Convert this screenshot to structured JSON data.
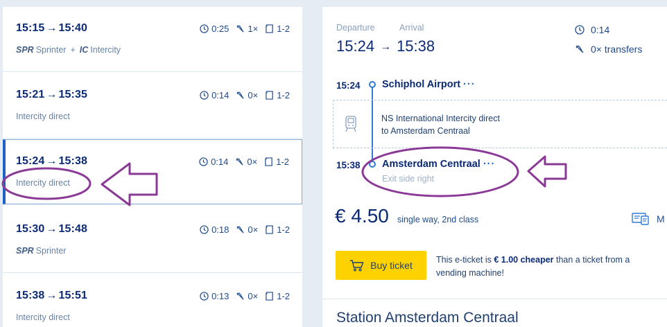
{
  "trips": [
    {
      "dep": "15:15",
      "arr": "15:40",
      "duration": "0:25",
      "transfers": "1×",
      "classes": "1-2",
      "type_text": "",
      "segments": [
        {
          "code": "SPR",
          "name": "Sprinter"
        },
        {
          "code": "IC",
          "name": "Intercity"
        }
      ],
      "plus": "+"
    },
    {
      "dep": "15:21",
      "arr": "15:35",
      "duration": "0:14",
      "transfers": "0×",
      "classes": "1-2",
      "type_text": "Intercity direct",
      "segments": []
    },
    {
      "dep": "15:24",
      "arr": "15:38",
      "duration": "0:14",
      "transfers": "0×",
      "classes": "1-2",
      "type_text": "Intercity direct",
      "segments": []
    },
    {
      "dep": "15:30",
      "arr": "15:48",
      "duration": "0:18",
      "transfers": "0×",
      "classes": "1-2",
      "type_text": "",
      "segments": [
        {
          "code": "SPR",
          "name": "Sprinter"
        }
      ]
    },
    {
      "dep": "15:38",
      "arr": "15:51",
      "duration": "0:13",
      "transfers": "0×",
      "classes": "1-2",
      "type_text": "Intercity direct",
      "segments": []
    }
  ],
  "arrow_glyph": "→",
  "detail": {
    "departure_label": "Departure",
    "arrival_label": "Arrival",
    "dep_time": "15:24",
    "arr_time": "15:38",
    "duration": "0:14",
    "transfers": "0× transfers",
    "origin_time": "15:24",
    "origin_name": "Schiphol Airport",
    "dest_time": "15:38",
    "dest_name": "Amsterdam Centraal",
    "more_dots": "···",
    "leg_line1": "NS International Intercity direct",
    "leg_line2": "to Amsterdam Centraal",
    "exit_info": "Exit side right",
    "price": "€ 4.50",
    "price_desc": "single way, 2nd class",
    "ticket_link": "M",
    "buy_label": "Buy ticket",
    "eticket_pre": "This e-ticket is ",
    "eticket_bold": "€ 1.00 cheaper",
    "eticket_post": " than a ticket from a vending machine!",
    "station_title": "Station Amsterdam Centraal"
  },
  "colors": {
    "background": "#e5ecf4",
    "text_primary": "#0b2a74",
    "accent_blue": "#1e63c4",
    "buy_yellow": "#fed200",
    "annotation_purple": "#8a3a96"
  },
  "icons": [
    "clock-icon",
    "transfer-icon",
    "class-icon",
    "train-icon",
    "cart-icon",
    "ticket-icon"
  ]
}
